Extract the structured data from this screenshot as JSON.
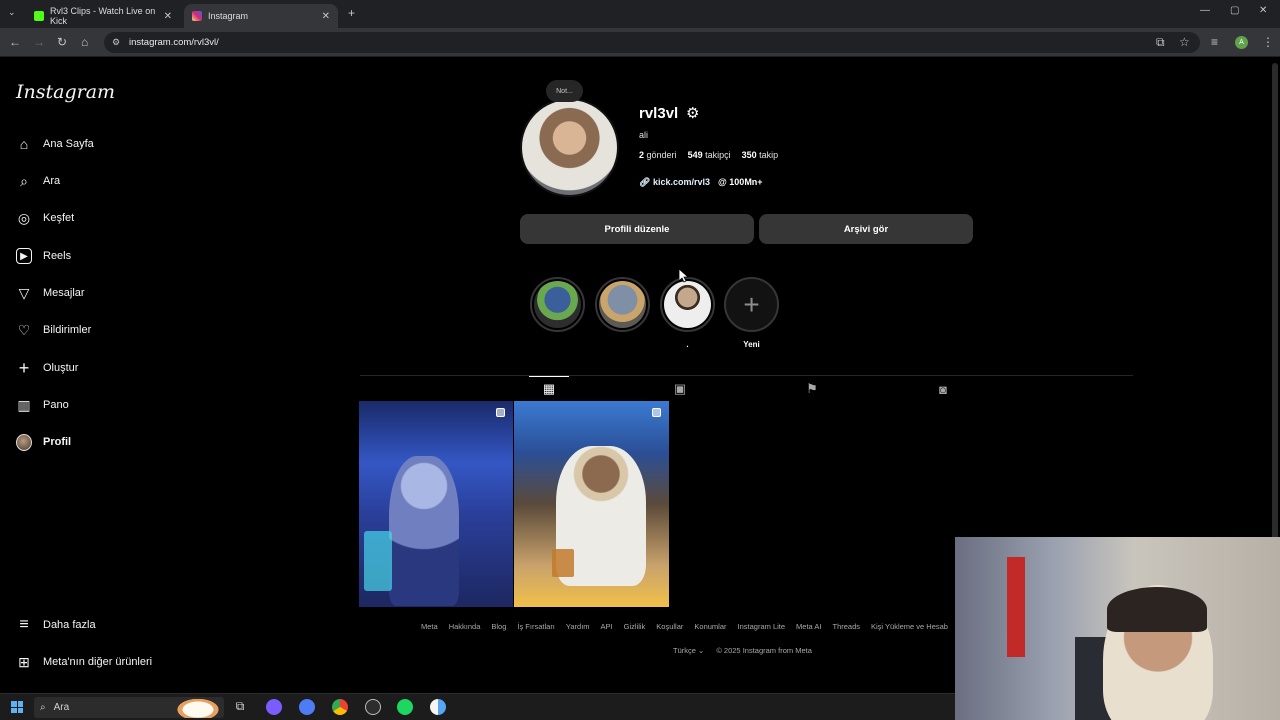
{
  "browser": {
    "tabs": [
      {
        "title": "Rvl3 Clips - Watch Live on Kick",
        "favicon_color": "#53fc18",
        "active": false
      },
      {
        "title": "Instagram",
        "favicon_color": "#d6249f",
        "active": true
      }
    ],
    "url": "instagram.com/rvl3vl/",
    "profile_initial": "A"
  },
  "sidebar": {
    "logo": "Instagram",
    "items": [
      {
        "label": "Ana Sayfa",
        "icon": "home-icon",
        "glyph": "⌂"
      },
      {
        "label": "Ara",
        "icon": "search-icon",
        "glyph": "⌕"
      },
      {
        "label": "Keşfet",
        "icon": "compass-icon",
        "glyph": "◎"
      },
      {
        "label": "Reels",
        "icon": "reels-icon",
        "glyph": "▶"
      },
      {
        "label": "Mesajlar",
        "icon": "messages-icon",
        "glyph": "▽"
      },
      {
        "label": "Bildirimler",
        "icon": "heart-icon",
        "glyph": "♡"
      },
      {
        "label": "Oluştur",
        "icon": "plus-icon",
        "glyph": "+"
      },
      {
        "label": "Pano",
        "icon": "dashboard-icon",
        "glyph": "▥"
      },
      {
        "label": "Profil",
        "icon": "profile-avatar",
        "glyph": ""
      }
    ],
    "more": {
      "label": "Daha fazla",
      "glyph": "≡"
    },
    "meta": {
      "label": "Meta'nın diğer ürünleri",
      "glyph": "⊞"
    }
  },
  "profile": {
    "note": "Not...",
    "username": "rvl3vl",
    "name": "ali",
    "posts_count": "2",
    "posts_label": "gönderi",
    "followers_count": "549",
    "followers_label": "takipçi",
    "following_count": "350",
    "following_label": "takip",
    "link": "kick.com/rvl3",
    "threads": "100Mn+",
    "edit_button": "Profili düzenle",
    "archive_button": "Arşivi gör"
  },
  "highlights": [
    {
      "label": "",
      "colors": [
        "#3a5f9a",
        "#6aa84f"
      ]
    },
    {
      "label": "",
      "colors": [
        "#7f8fa6",
        "#c9a46b"
      ]
    },
    {
      "label": ".",
      "colors": [
        "#c4a88e",
        "#eeeeee"
      ]
    },
    {
      "label": "Yeni",
      "colors": []
    }
  ],
  "profile_tabs": [
    {
      "name": "posts-tab",
      "glyph": "▦",
      "active": true
    },
    {
      "name": "reels-tab",
      "glyph": "▣",
      "active": false
    },
    {
      "name": "saved-tab",
      "glyph": "⚑",
      "active": false
    },
    {
      "name": "tagged-tab",
      "glyph": "◙",
      "active": false
    }
  ],
  "footer": {
    "links": [
      "Meta",
      "Hakkında",
      "Blog",
      "İş Fırsatları",
      "Yardım",
      "API",
      "Gizlilik",
      "Koşullar",
      "Konumlar",
      "Instagram Lite",
      "Meta AI",
      "Threads",
      "Kişi Yükleme ve Hesab"
    ],
    "language": "Türkçe",
    "copyright": "© 2025 Instagram from Meta"
  },
  "taskbar": {
    "search_placeholder": "Ara"
  }
}
